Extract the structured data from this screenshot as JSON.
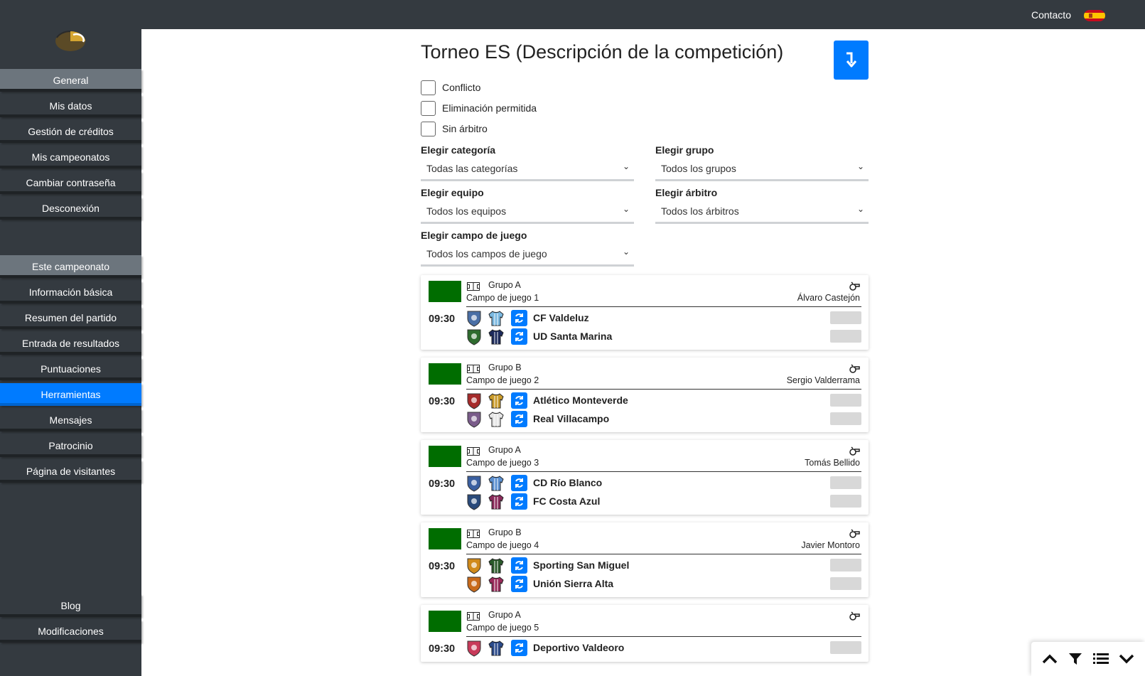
{
  "topbar": {
    "contact": "Contacto",
    "language_flag": "es-flag-icon"
  },
  "sidebar": {
    "logo": "app-logo",
    "items": [
      {
        "label": "General",
        "kind": "header"
      },
      {
        "label": "Mis datos"
      },
      {
        "label": "Gestión de créditos"
      },
      {
        "label": "Mis campeonatos"
      },
      {
        "label": "Cambiar contraseña"
      },
      {
        "label": "Desconexión"
      },
      {
        "label": "Este campeonato",
        "kind": "header"
      },
      {
        "label": "Información básica"
      },
      {
        "label": "Resumen del partido"
      },
      {
        "label": "Entrada de resultados"
      },
      {
        "label": "Puntuaciones"
      },
      {
        "label": "Herramientas",
        "active": true
      },
      {
        "label": "Mensajes"
      },
      {
        "label": "Patrocinio"
      },
      {
        "label": "Página de visitantes"
      },
      {
        "label": "Blog"
      },
      {
        "label": "Modificaciones"
      }
    ]
  },
  "main": {
    "title": "Torneo ES (Descripción de la competición)",
    "download_icon": "download-arrow-icon",
    "checkboxes": [
      "Conflicto",
      "Eliminación permitida",
      "Sin árbitro"
    ],
    "filters": {
      "category": {
        "label": "Elegir categoría",
        "value": "Todas las categorías"
      },
      "group": {
        "label": "Elegir grupo",
        "value": "Todos los grupos"
      },
      "team": {
        "label": "Elegir equipo",
        "value": "Todos los equipos"
      },
      "referee": {
        "label": "Elegir árbitro",
        "value": "Todos los árbitros"
      },
      "field": {
        "label": "Elegir campo de juego",
        "value": "Todos los campos de juego"
      }
    },
    "matches": [
      {
        "group": "Grupo A",
        "field": "Campo de juego 1",
        "referee": "Álvaro Castejón",
        "time": "09:30",
        "teams": [
          {
            "name": "CF Valdeluz",
            "crest_color": "#4a6fa5",
            "shirt_color": "#7ab8e0"
          },
          {
            "name": "UD Santa Marina",
            "crest_color": "#2e6b2e",
            "shirt_color": "#1c2a5c"
          }
        ]
      },
      {
        "group": "Grupo B",
        "field": "Campo de juego 2",
        "referee": "Sergio Valderrama",
        "time": "09:30",
        "teams": [
          {
            "name": "Atlético Monteverde",
            "crest_color": "#a52a2a",
            "shirt_color": "#c89a2a"
          },
          {
            "name": "Real Villacampo",
            "crest_color": "#7a5c8a",
            "shirt_color": "#e6e6e6"
          }
        ]
      },
      {
        "group": "Grupo A",
        "field": "Campo de juego 3",
        "referee": "Tomás Bellido",
        "time": "09:30",
        "teams": [
          {
            "name": "CD Río Blanco",
            "crest_color": "#3a5fa0",
            "shirt_color": "#5a8fd0"
          },
          {
            "name": "FC Costa Azul",
            "crest_color": "#2a4a7a",
            "shirt_color": "#8a2a5a"
          }
        ]
      },
      {
        "group": "Grupo B",
        "field": "Campo de juego 4",
        "referee": "Javier Montoro",
        "time": "09:30",
        "teams": [
          {
            "name": "Sporting San Miguel",
            "crest_color": "#d08a1a",
            "shirt_color": "#2a5a2a"
          },
          {
            "name": "Unión Sierra Alta",
            "crest_color": "#c86a1a",
            "shirt_color": "#9a2a5a"
          }
        ]
      },
      {
        "group": "Grupo A",
        "field": "Campo de juego 5",
        "referee": "",
        "time": "09:30",
        "teams": [
          {
            "name": "Deportivo Valdeoro",
            "crest_color": "#c83a5a",
            "shirt_color": "#2a4a8a"
          }
        ]
      }
    ]
  },
  "float_bar": [
    "chevron-up-icon",
    "filter-icon",
    "list-icon",
    "chevron-down-icon"
  ]
}
